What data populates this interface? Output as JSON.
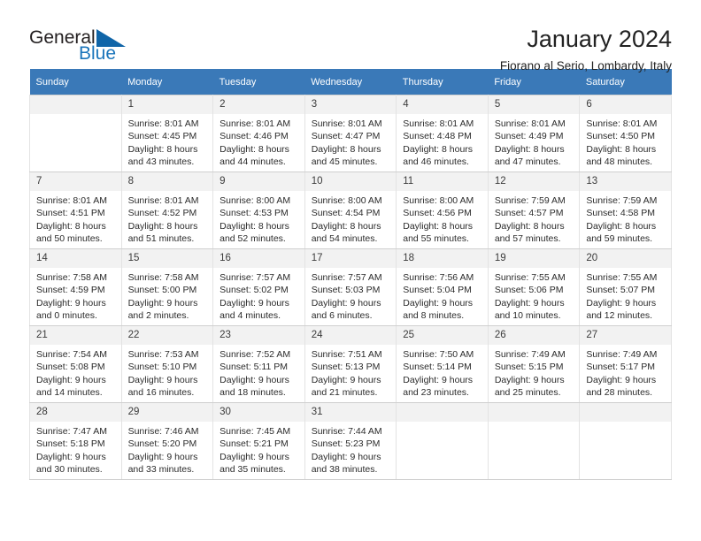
{
  "brand": {
    "word1": "General",
    "word2": "Blue",
    "triangle_color": "#1065a8",
    "blue_color": "#1b75bb"
  },
  "header": {
    "month_title": "January 2024",
    "location": "Fiorano al Serio, Lombardy, Italy"
  },
  "calendar": {
    "header_bg": "#3a79b8",
    "daynum_bg": "#f2f2f2",
    "weekday_names": [
      "Sunday",
      "Monday",
      "Tuesday",
      "Wednesday",
      "Thursday",
      "Friday",
      "Saturday"
    ],
    "weeks": [
      [
        {
          "day": "",
          "sunrise": "",
          "sunset": "",
          "daylight1": "",
          "daylight2": ""
        },
        {
          "day": "1",
          "sunrise": "Sunrise: 8:01 AM",
          "sunset": "Sunset: 4:45 PM",
          "daylight1": "Daylight: 8 hours",
          "daylight2": "and 43 minutes."
        },
        {
          "day": "2",
          "sunrise": "Sunrise: 8:01 AM",
          "sunset": "Sunset: 4:46 PM",
          "daylight1": "Daylight: 8 hours",
          "daylight2": "and 44 minutes."
        },
        {
          "day": "3",
          "sunrise": "Sunrise: 8:01 AM",
          "sunset": "Sunset: 4:47 PM",
          "daylight1": "Daylight: 8 hours",
          "daylight2": "and 45 minutes."
        },
        {
          "day": "4",
          "sunrise": "Sunrise: 8:01 AM",
          "sunset": "Sunset: 4:48 PM",
          "daylight1": "Daylight: 8 hours",
          "daylight2": "and 46 minutes."
        },
        {
          "day": "5",
          "sunrise": "Sunrise: 8:01 AM",
          "sunset": "Sunset: 4:49 PM",
          "daylight1": "Daylight: 8 hours",
          "daylight2": "and 47 minutes."
        },
        {
          "day": "6",
          "sunrise": "Sunrise: 8:01 AM",
          "sunset": "Sunset: 4:50 PM",
          "daylight1": "Daylight: 8 hours",
          "daylight2": "and 48 minutes."
        }
      ],
      [
        {
          "day": "7",
          "sunrise": "Sunrise: 8:01 AM",
          "sunset": "Sunset: 4:51 PM",
          "daylight1": "Daylight: 8 hours",
          "daylight2": "and 50 minutes."
        },
        {
          "day": "8",
          "sunrise": "Sunrise: 8:01 AM",
          "sunset": "Sunset: 4:52 PM",
          "daylight1": "Daylight: 8 hours",
          "daylight2": "and 51 minutes."
        },
        {
          "day": "9",
          "sunrise": "Sunrise: 8:00 AM",
          "sunset": "Sunset: 4:53 PM",
          "daylight1": "Daylight: 8 hours",
          "daylight2": "and 52 minutes."
        },
        {
          "day": "10",
          "sunrise": "Sunrise: 8:00 AM",
          "sunset": "Sunset: 4:54 PM",
          "daylight1": "Daylight: 8 hours",
          "daylight2": "and 54 minutes."
        },
        {
          "day": "11",
          "sunrise": "Sunrise: 8:00 AM",
          "sunset": "Sunset: 4:56 PM",
          "daylight1": "Daylight: 8 hours",
          "daylight2": "and 55 minutes."
        },
        {
          "day": "12",
          "sunrise": "Sunrise: 7:59 AM",
          "sunset": "Sunset: 4:57 PM",
          "daylight1": "Daylight: 8 hours",
          "daylight2": "and 57 minutes."
        },
        {
          "day": "13",
          "sunrise": "Sunrise: 7:59 AM",
          "sunset": "Sunset: 4:58 PM",
          "daylight1": "Daylight: 8 hours",
          "daylight2": "and 59 minutes."
        }
      ],
      [
        {
          "day": "14",
          "sunrise": "Sunrise: 7:58 AM",
          "sunset": "Sunset: 4:59 PM",
          "daylight1": "Daylight: 9 hours",
          "daylight2": "and 0 minutes."
        },
        {
          "day": "15",
          "sunrise": "Sunrise: 7:58 AM",
          "sunset": "Sunset: 5:00 PM",
          "daylight1": "Daylight: 9 hours",
          "daylight2": "and 2 minutes."
        },
        {
          "day": "16",
          "sunrise": "Sunrise: 7:57 AM",
          "sunset": "Sunset: 5:02 PM",
          "daylight1": "Daylight: 9 hours",
          "daylight2": "and 4 minutes."
        },
        {
          "day": "17",
          "sunrise": "Sunrise: 7:57 AM",
          "sunset": "Sunset: 5:03 PM",
          "daylight1": "Daylight: 9 hours",
          "daylight2": "and 6 minutes."
        },
        {
          "day": "18",
          "sunrise": "Sunrise: 7:56 AM",
          "sunset": "Sunset: 5:04 PM",
          "daylight1": "Daylight: 9 hours",
          "daylight2": "and 8 minutes."
        },
        {
          "day": "19",
          "sunrise": "Sunrise: 7:55 AM",
          "sunset": "Sunset: 5:06 PM",
          "daylight1": "Daylight: 9 hours",
          "daylight2": "and 10 minutes."
        },
        {
          "day": "20",
          "sunrise": "Sunrise: 7:55 AM",
          "sunset": "Sunset: 5:07 PM",
          "daylight1": "Daylight: 9 hours",
          "daylight2": "and 12 minutes."
        }
      ],
      [
        {
          "day": "21",
          "sunrise": "Sunrise: 7:54 AM",
          "sunset": "Sunset: 5:08 PM",
          "daylight1": "Daylight: 9 hours",
          "daylight2": "and 14 minutes."
        },
        {
          "day": "22",
          "sunrise": "Sunrise: 7:53 AM",
          "sunset": "Sunset: 5:10 PM",
          "daylight1": "Daylight: 9 hours",
          "daylight2": "and 16 minutes."
        },
        {
          "day": "23",
          "sunrise": "Sunrise: 7:52 AM",
          "sunset": "Sunset: 5:11 PM",
          "daylight1": "Daylight: 9 hours",
          "daylight2": "and 18 minutes."
        },
        {
          "day": "24",
          "sunrise": "Sunrise: 7:51 AM",
          "sunset": "Sunset: 5:13 PM",
          "daylight1": "Daylight: 9 hours",
          "daylight2": "and 21 minutes."
        },
        {
          "day": "25",
          "sunrise": "Sunrise: 7:50 AM",
          "sunset": "Sunset: 5:14 PM",
          "daylight1": "Daylight: 9 hours",
          "daylight2": "and 23 minutes."
        },
        {
          "day": "26",
          "sunrise": "Sunrise: 7:49 AM",
          "sunset": "Sunset: 5:15 PM",
          "daylight1": "Daylight: 9 hours",
          "daylight2": "and 25 minutes."
        },
        {
          "day": "27",
          "sunrise": "Sunrise: 7:49 AM",
          "sunset": "Sunset: 5:17 PM",
          "daylight1": "Daylight: 9 hours",
          "daylight2": "and 28 minutes."
        }
      ],
      [
        {
          "day": "28",
          "sunrise": "Sunrise: 7:47 AM",
          "sunset": "Sunset: 5:18 PM",
          "daylight1": "Daylight: 9 hours",
          "daylight2": "and 30 minutes."
        },
        {
          "day": "29",
          "sunrise": "Sunrise: 7:46 AM",
          "sunset": "Sunset: 5:20 PM",
          "daylight1": "Daylight: 9 hours",
          "daylight2": "and 33 minutes."
        },
        {
          "day": "30",
          "sunrise": "Sunrise: 7:45 AM",
          "sunset": "Sunset: 5:21 PM",
          "daylight1": "Daylight: 9 hours",
          "daylight2": "and 35 minutes."
        },
        {
          "day": "31",
          "sunrise": "Sunrise: 7:44 AM",
          "sunset": "Sunset: 5:23 PM",
          "daylight1": "Daylight: 9 hours",
          "daylight2": "and 38 minutes."
        },
        {
          "day": "",
          "sunrise": "",
          "sunset": "",
          "daylight1": "",
          "daylight2": ""
        },
        {
          "day": "",
          "sunrise": "",
          "sunset": "",
          "daylight1": "",
          "daylight2": ""
        },
        {
          "day": "",
          "sunrise": "",
          "sunset": "",
          "daylight1": "",
          "daylight2": ""
        }
      ]
    ]
  }
}
